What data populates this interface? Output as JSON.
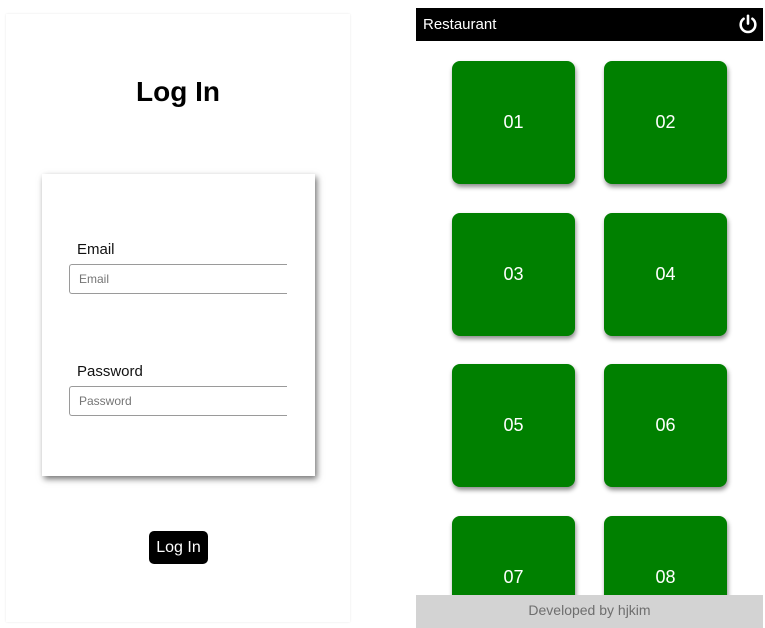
{
  "login": {
    "title": "Log In",
    "email_label": "Email",
    "email_placeholder": "Email",
    "email_value": "",
    "password_label": "Password",
    "password_placeholder": "Password",
    "password_value": "",
    "button_label": "Log In"
  },
  "restaurant": {
    "app_title": "Restaurant",
    "power_icon": "power-icon",
    "tile_color": "#008000",
    "tables": [
      "01",
      "02",
      "03",
      "04",
      "05",
      "06",
      "07",
      "08"
    ],
    "footer_text": "Developed by hjkim"
  }
}
